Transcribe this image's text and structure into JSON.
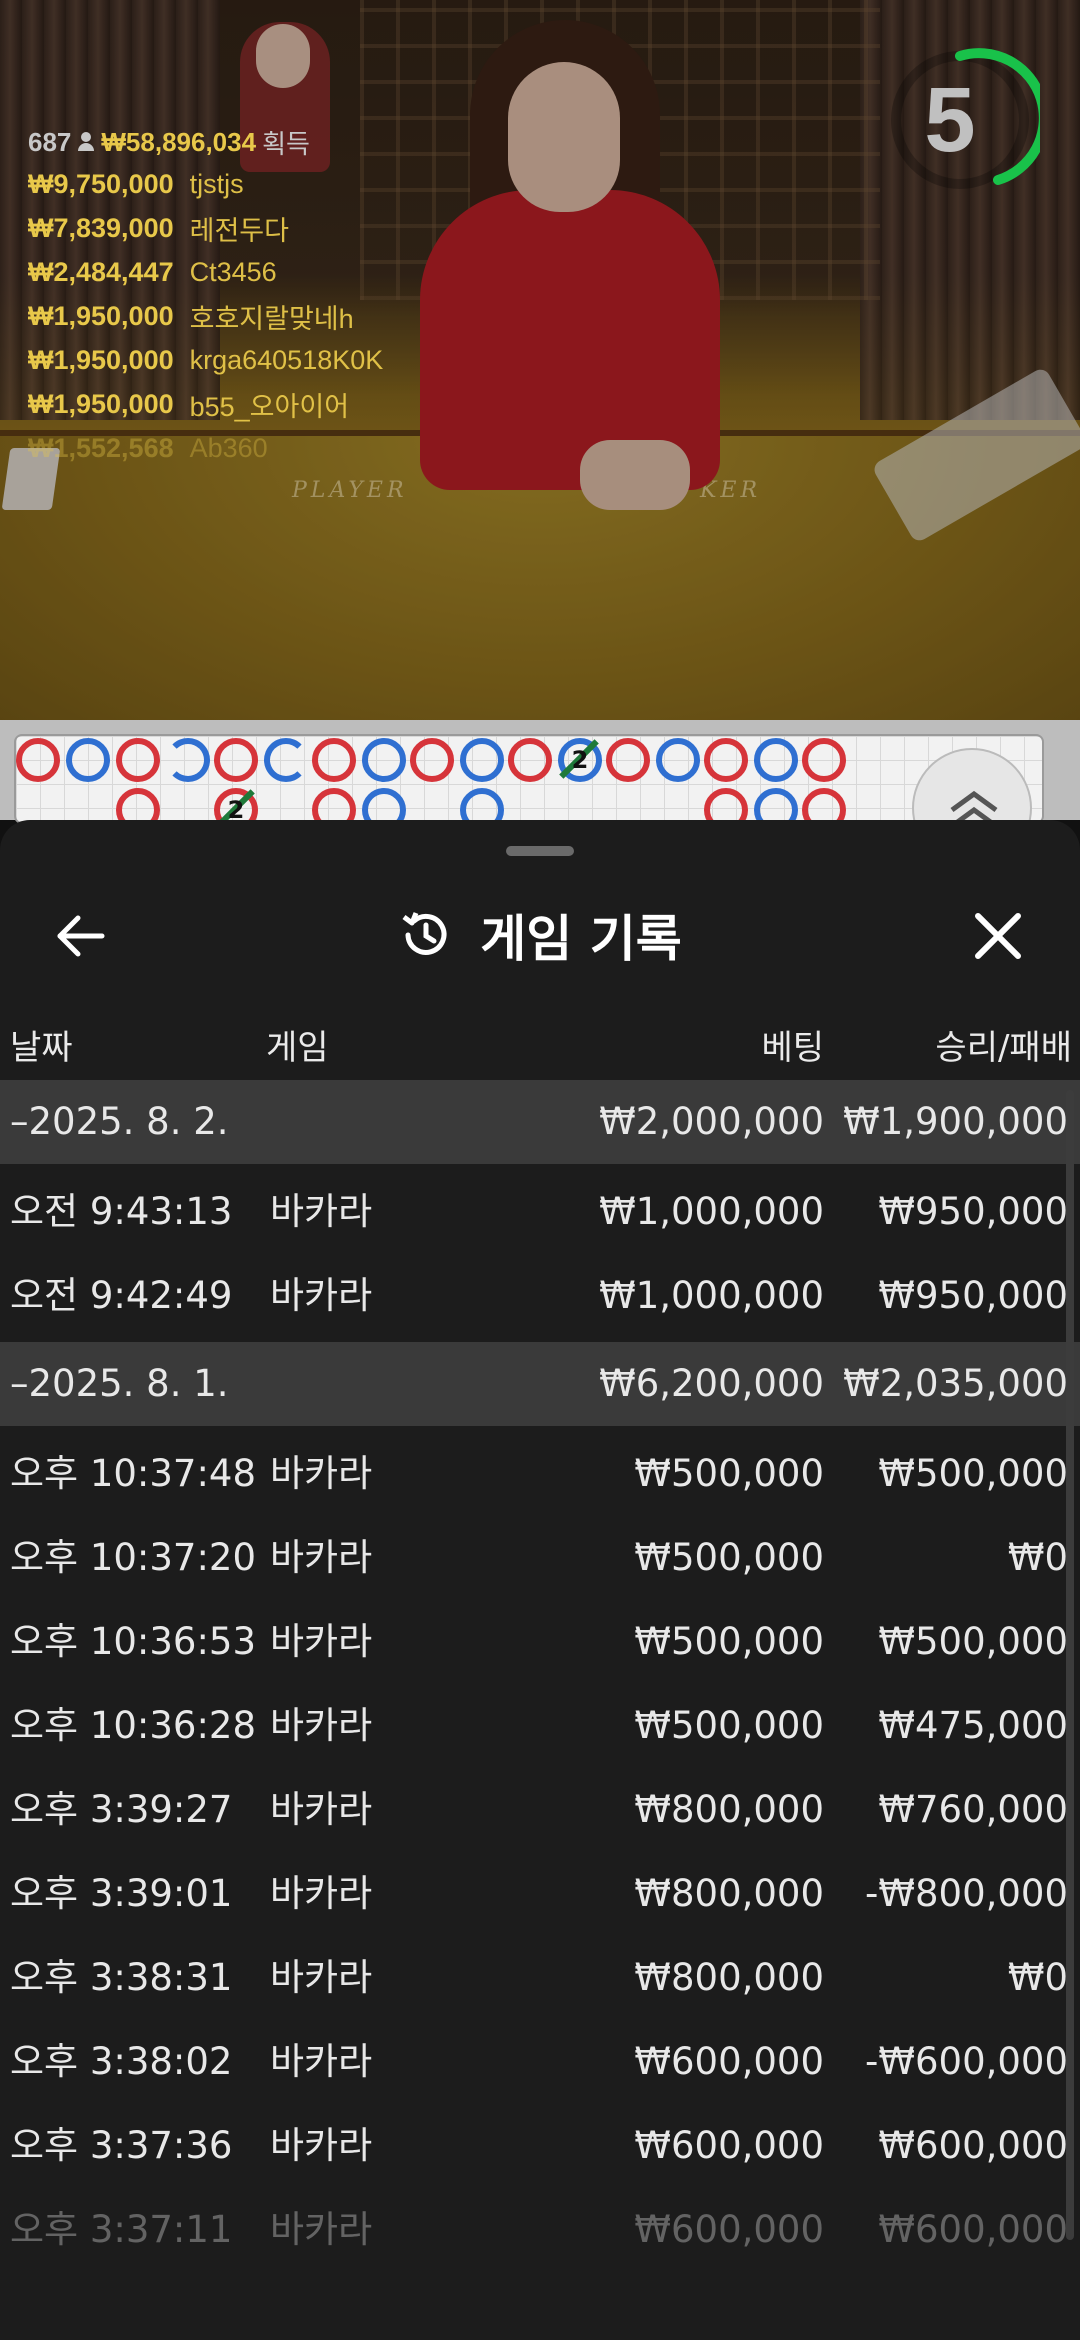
{
  "stream": {
    "table_left": "PLAYER",
    "table_right": "KER",
    "countdown": "5",
    "colors": {
      "gold": "#e8c84a",
      "timer_green": "#19c24a",
      "player_blue": "#2f6fd1",
      "banker_red": "#d6343a"
    }
  },
  "winners": {
    "count": "687",
    "total": "₩58,896,034",
    "suffix": "획득",
    "rows": [
      {
        "amount": "₩9,750,000",
        "user": "tjstjs"
      },
      {
        "amount": "₩7,839,000",
        "user": "레전두다"
      },
      {
        "amount": "₩2,484,447",
        "user": "Ct3456"
      },
      {
        "amount": "₩1,950,000",
        "user": "호호지랄맞네h"
      },
      {
        "amount": "₩1,950,000",
        "user": "krga640518K0K"
      },
      {
        "amount": "₩1,950,000",
        "user": "b55_오아이어"
      },
      {
        "amount": "₩1,552,568",
        "user": "Ab360"
      }
    ]
  },
  "roadmap": {
    "marked_count": "2"
  },
  "sheet": {
    "title": "게임 기록",
    "title_icon": "history-icon",
    "columns": {
      "date": "날짜",
      "game": "게임",
      "bet": "베팅",
      "result": "승리/패배"
    },
    "groups": [
      {
        "date": "–2025. 8. 2.",
        "bet": "₩2,000,000",
        "result": "₩1,900,000",
        "rows": [
          {
            "time": "오전 9:43:13",
            "game": "바카라",
            "bet": "₩1,000,000",
            "result": "₩950,000"
          },
          {
            "time": "오전 9:42:49",
            "game": "바카라",
            "bet": "₩1,000,000",
            "result": "₩950,000"
          }
        ]
      },
      {
        "date": "–2025. 8. 1.",
        "bet": "₩6,200,000",
        "result": "₩2,035,000",
        "rows": [
          {
            "time": "오후 10:37:48",
            "game": "바카라",
            "bet": "₩500,000",
            "result": "₩500,000"
          },
          {
            "time": "오후 10:37:20",
            "game": "바카라",
            "bet": "₩500,000",
            "result": "₩0"
          },
          {
            "time": "오후 10:36:53",
            "game": "바카라",
            "bet": "₩500,000",
            "result": "₩500,000"
          },
          {
            "time": "오후 10:36:28",
            "game": "바카라",
            "bet": "₩500,000",
            "result": "₩475,000"
          },
          {
            "time": "오후 3:39:27",
            "game": "바카라",
            "bet": "₩800,000",
            "result": "₩760,000"
          },
          {
            "time": "오후 3:39:01",
            "game": "바카라",
            "bet": "₩800,000",
            "result": "-₩800,000"
          },
          {
            "time": "오후 3:38:31",
            "game": "바카라",
            "bet": "₩800,000",
            "result": "₩0"
          },
          {
            "time": "오후 3:38:02",
            "game": "바카라",
            "bet": "₩600,000",
            "result": "-₩600,000"
          },
          {
            "time": "오후 3:37:36",
            "game": "바카라",
            "bet": "₩600,000",
            "result": "₩600,000"
          },
          {
            "time": "오후 3:37:11",
            "game": "바카라",
            "bet": "₩600,000",
            "result": "₩600,000"
          }
        ]
      }
    ]
  }
}
